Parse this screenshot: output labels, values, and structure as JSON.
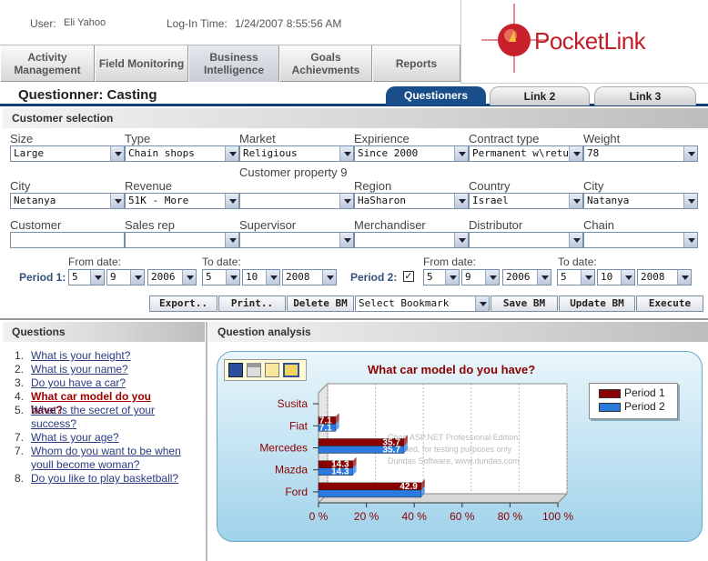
{
  "header": {
    "user_label": "User:",
    "user_name": "Eli Yahoo",
    "login_label": "Log-In Time:",
    "login_time": "1/24/2007 8:55:56 AM",
    "logo_text": "PocketLink"
  },
  "nav": [
    {
      "label": "Activity Management"
    },
    {
      "label": "Field Monitoring"
    },
    {
      "label": "Business Intelligence"
    },
    {
      "label": "Goals Achievments"
    },
    {
      "label": "Reports"
    }
  ],
  "page_title": "Questionner: Casting",
  "tabs": [
    {
      "label": "Questioners"
    },
    {
      "label": "Link 2"
    },
    {
      "label": "Link 3"
    }
  ],
  "customer_selection": {
    "title": "Customer selection",
    "row1": [
      {
        "label": "Size",
        "value": "Large"
      },
      {
        "label": "Type",
        "value": "Chain shops"
      },
      {
        "label": "Market",
        "value": "Religious"
      },
      {
        "label": "Expirience",
        "value": "Since 2000"
      },
      {
        "label": "Contract type",
        "value": "Permanent w\\retu"
      },
      {
        "label": "Weight",
        "value": "78"
      }
    ],
    "row2": [
      {
        "label": "City",
        "value": "Netanya"
      },
      {
        "label": "Revenue",
        "value": "51K - More"
      },
      {
        "label": "Customer property 9",
        "value": ""
      },
      {
        "label": "Region",
        "value": "HaSharon"
      },
      {
        "label": "Country",
        "value": "Israel"
      },
      {
        "label": "City",
        "value": "Natanya"
      }
    ],
    "row3": [
      {
        "label": "Customer",
        "value": ""
      },
      {
        "label": "Sales rep",
        "value": ""
      },
      {
        "label": "Supervisor",
        "value": ""
      },
      {
        "label": "Merchandiser",
        "value": ""
      },
      {
        "label": "Distributor",
        "value": ""
      },
      {
        "label": "Chain",
        "value": ""
      }
    ]
  },
  "periods": {
    "from_label": "From date:",
    "to_label": "To date:",
    "p1": {
      "label": "Period 1:",
      "from": [
        "5",
        "9",
        "2006"
      ],
      "to": [
        "5",
        "10",
        "2008"
      ]
    },
    "p2": {
      "label": "Period 2:",
      "checked": true,
      "from": [
        "5",
        "9",
        "2006"
      ],
      "to": [
        "5",
        "10",
        "2008"
      ]
    }
  },
  "actions": {
    "export": "Export..",
    "print": "Print..",
    "delete_bm": "Delete BM",
    "bookmark": "Select Bookmark",
    "save_bm": "Save BM",
    "update_bm": "Update BM",
    "execute": "Execute"
  },
  "questions": {
    "title": "Questions",
    "items": [
      {
        "num": "1.",
        "text": "What is your height?"
      },
      {
        "num": "2.",
        "text": "What is your name?"
      },
      {
        "num": "3.",
        "text": "Do you have a car?"
      },
      {
        "num": "4.",
        "text": "What car model do you have?"
      },
      {
        "num": "5.",
        "text": "What is the secret of your success?"
      },
      {
        "num": "7.",
        "text": "What is your age?"
      },
      {
        "num": "7.",
        "text": "Whom do you want to be when youll become woman?"
      },
      {
        "num": "8.",
        "text": "Do you like to play basketball?"
      }
    ]
  },
  "analysis_title": "Question analysis",
  "watermark": [
    "Chart ASP.NET Professional Edition",
    "Enabled, for testing purposes only",
    "Dundas Software, www.dundas.com"
  ],
  "chart_data": {
    "type": "bar",
    "orientation": "horizontal",
    "title": "What car model do you have?",
    "categories": [
      "Ford",
      "Mazda",
      "Mercedes",
      "Fiat",
      "Susita"
    ],
    "series": [
      {
        "name": "Period 1",
        "color": "#8b0000",
        "values": [
          42.9,
          14.3,
          35.7,
          7.1,
          0
        ]
      },
      {
        "name": "Period 2",
        "color": "#2a7ae0",
        "values": [
          42.9,
          14.3,
          35.7,
          7.1,
          0
        ]
      }
    ],
    "data_labels": {
      "Ford": [
        "42.9",
        ""
      ],
      "Mazda": [
        "14.3",
        "14.3"
      ],
      "Mercedes": [
        "35.7",
        "35.7"
      ],
      "Fiat": [
        "7.1",
        "7.1"
      ]
    },
    "xlim": [
      0,
      100
    ],
    "xticks": [
      "0 %",
      "20 %",
      "40 %",
      "60 %",
      "80 %",
      "100 %"
    ],
    "legend": "top-right",
    "grid": true
  },
  "colors": {
    "accent": "#1a4e8a",
    "logo_red": "#c0202a"
  }
}
